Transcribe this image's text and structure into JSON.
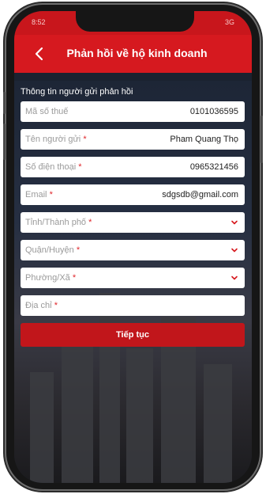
{
  "statusbar": {
    "time": "8:52",
    "right": "3G"
  },
  "header": {
    "title": "Phản hồi về hộ kinh doanh"
  },
  "section": {
    "label": "Thông tin người gửi phản hồi"
  },
  "fields": {
    "tax": {
      "placeholder": "Mã số thuế",
      "required": "",
      "value": "0101036595"
    },
    "name": {
      "placeholder": "Tên người gửi",
      "required": "*",
      "value": "Pham Quang Thọ"
    },
    "phone": {
      "placeholder": "Số điện thoại",
      "required": "*",
      "value": "0965321456"
    },
    "email": {
      "placeholder": "Email",
      "required": "*",
      "value": "sdgsdb@gmail.com"
    },
    "province": {
      "placeholder": "Tỉnh/Thành phố",
      "required": "*"
    },
    "district": {
      "placeholder": "Quận/Huyện",
      "required": "*"
    },
    "ward": {
      "placeholder": "Phường/Xã",
      "required": "*"
    },
    "address": {
      "placeholder": "Địa chỉ",
      "required": "*"
    }
  },
  "actions": {
    "submit_label": "Tiếp tục"
  },
  "colors": {
    "header": "#d6191f",
    "button": "#c1161b",
    "required": "#e0262b"
  },
  "icons": {
    "back": "chevron-left-icon",
    "dropdown": "chevron-down-icon"
  }
}
